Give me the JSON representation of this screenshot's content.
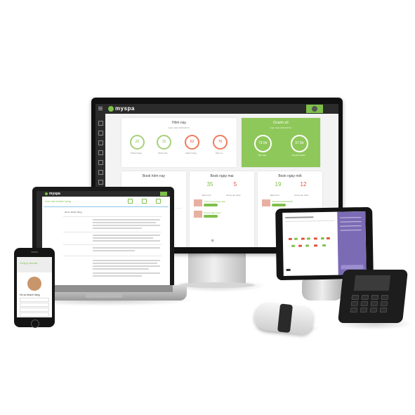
{
  "monitor": {
    "app_name": "myspa",
    "today": {
      "title": "Hôm nay",
      "subtitle": "(Cập nhật: 06/01/2017)",
      "stats": [
        {
          "value": "22",
          "label": "Khách hàng"
        },
        {
          "value": "15",
          "label": "Nhân viên"
        },
        {
          "value": "62",
          "label": "Khách hàng"
        },
        {
          "value": "70",
          "label": "Dịch vụ"
        }
      ]
    },
    "revenue": {
      "title": "Doanh số",
      "subtitle": "(Cập nhật: 06/01/2017)",
      "stats": [
        {
          "value": "72.5tr",
          "label": "Tiền mặt"
        },
        {
          "value": "37.5tr",
          "label": "Chuyển khoản"
        }
      ]
    },
    "bottom_cards": [
      {
        "title": "Book hôm nay"
      },
      {
        "title": "Book ngày mai",
        "left_value": "35",
        "right_value": "5",
        "left_label": "Đặt trước",
        "right_label": "Chưa xác nhận"
      },
      {
        "title": "Book ngày mốt",
        "left_value": "19",
        "right_value": "12",
        "left_label": "Đặt trước",
        "right_label": "Chưa xác nhận"
      }
    ],
    "bookings": [
      {
        "name": "Trịnh Hương Ngọc Đan",
        "badge": "Đã xác nhận"
      },
      {
        "name": "Dương Ngọc Hàm",
        "badge": "Đã xác nhận"
      }
    ]
  },
  "laptop": {
    "app_name": "myspa",
    "page_title": "Lịch hẹn khách hàng",
    "section_title": "Hồ sơ khách hàng"
  },
  "phone": {
    "header_title": "Công ty của bạn",
    "section_title": "Hồ sơ khách hàng"
  },
  "colors": {
    "accent": "#7ec04a",
    "dark": "#2b2b2b",
    "alert": "#e0503a",
    "pos_panel": "#7b6bb5"
  },
  "icons": [
    "user-avatar-icon",
    "apple-logo-icon",
    "menu-icon"
  ]
}
